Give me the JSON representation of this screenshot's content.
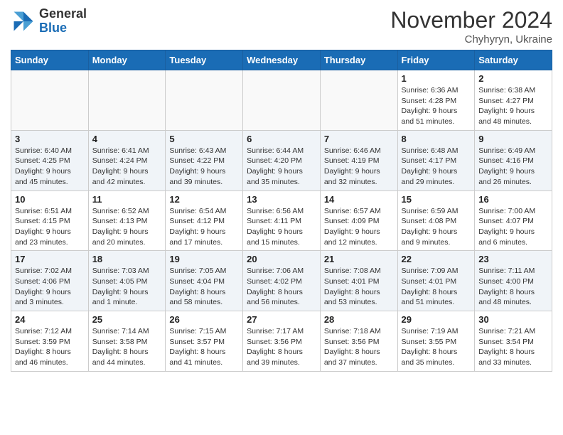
{
  "header": {
    "logo_general": "General",
    "logo_blue": "Blue",
    "month_title": "November 2024",
    "subtitle": "Chyhyryn, Ukraine"
  },
  "days_of_week": [
    "Sunday",
    "Monday",
    "Tuesday",
    "Wednesday",
    "Thursday",
    "Friday",
    "Saturday"
  ],
  "weeks": [
    [
      {
        "day": "",
        "info": ""
      },
      {
        "day": "",
        "info": ""
      },
      {
        "day": "",
        "info": ""
      },
      {
        "day": "",
        "info": ""
      },
      {
        "day": "",
        "info": ""
      },
      {
        "day": "1",
        "info": "Sunrise: 6:36 AM\nSunset: 4:28 PM\nDaylight: 9 hours\nand 51 minutes."
      },
      {
        "day": "2",
        "info": "Sunrise: 6:38 AM\nSunset: 4:27 PM\nDaylight: 9 hours\nand 48 minutes."
      }
    ],
    [
      {
        "day": "3",
        "info": "Sunrise: 6:40 AM\nSunset: 4:25 PM\nDaylight: 9 hours\nand 45 minutes."
      },
      {
        "day": "4",
        "info": "Sunrise: 6:41 AM\nSunset: 4:24 PM\nDaylight: 9 hours\nand 42 minutes."
      },
      {
        "day": "5",
        "info": "Sunrise: 6:43 AM\nSunset: 4:22 PM\nDaylight: 9 hours\nand 39 minutes."
      },
      {
        "day": "6",
        "info": "Sunrise: 6:44 AM\nSunset: 4:20 PM\nDaylight: 9 hours\nand 35 minutes."
      },
      {
        "day": "7",
        "info": "Sunrise: 6:46 AM\nSunset: 4:19 PM\nDaylight: 9 hours\nand 32 minutes."
      },
      {
        "day": "8",
        "info": "Sunrise: 6:48 AM\nSunset: 4:17 PM\nDaylight: 9 hours\nand 29 minutes."
      },
      {
        "day": "9",
        "info": "Sunrise: 6:49 AM\nSunset: 4:16 PM\nDaylight: 9 hours\nand 26 minutes."
      }
    ],
    [
      {
        "day": "10",
        "info": "Sunrise: 6:51 AM\nSunset: 4:15 PM\nDaylight: 9 hours\nand 23 minutes."
      },
      {
        "day": "11",
        "info": "Sunrise: 6:52 AM\nSunset: 4:13 PM\nDaylight: 9 hours\nand 20 minutes."
      },
      {
        "day": "12",
        "info": "Sunrise: 6:54 AM\nSunset: 4:12 PM\nDaylight: 9 hours\nand 17 minutes."
      },
      {
        "day": "13",
        "info": "Sunrise: 6:56 AM\nSunset: 4:11 PM\nDaylight: 9 hours\nand 15 minutes."
      },
      {
        "day": "14",
        "info": "Sunrise: 6:57 AM\nSunset: 4:09 PM\nDaylight: 9 hours\nand 12 minutes."
      },
      {
        "day": "15",
        "info": "Sunrise: 6:59 AM\nSunset: 4:08 PM\nDaylight: 9 hours\nand 9 minutes."
      },
      {
        "day": "16",
        "info": "Sunrise: 7:00 AM\nSunset: 4:07 PM\nDaylight: 9 hours\nand 6 minutes."
      }
    ],
    [
      {
        "day": "17",
        "info": "Sunrise: 7:02 AM\nSunset: 4:06 PM\nDaylight: 9 hours\nand 3 minutes."
      },
      {
        "day": "18",
        "info": "Sunrise: 7:03 AM\nSunset: 4:05 PM\nDaylight: 9 hours\nand 1 minute."
      },
      {
        "day": "19",
        "info": "Sunrise: 7:05 AM\nSunset: 4:04 PM\nDaylight: 8 hours\nand 58 minutes."
      },
      {
        "day": "20",
        "info": "Sunrise: 7:06 AM\nSunset: 4:02 PM\nDaylight: 8 hours\nand 56 minutes."
      },
      {
        "day": "21",
        "info": "Sunrise: 7:08 AM\nSunset: 4:01 PM\nDaylight: 8 hours\nand 53 minutes."
      },
      {
        "day": "22",
        "info": "Sunrise: 7:09 AM\nSunset: 4:01 PM\nDaylight: 8 hours\nand 51 minutes."
      },
      {
        "day": "23",
        "info": "Sunrise: 7:11 AM\nSunset: 4:00 PM\nDaylight: 8 hours\nand 48 minutes."
      }
    ],
    [
      {
        "day": "24",
        "info": "Sunrise: 7:12 AM\nSunset: 3:59 PM\nDaylight: 8 hours\nand 46 minutes."
      },
      {
        "day": "25",
        "info": "Sunrise: 7:14 AM\nSunset: 3:58 PM\nDaylight: 8 hours\nand 44 minutes."
      },
      {
        "day": "26",
        "info": "Sunrise: 7:15 AM\nSunset: 3:57 PM\nDaylight: 8 hours\nand 41 minutes."
      },
      {
        "day": "27",
        "info": "Sunrise: 7:17 AM\nSunset: 3:56 PM\nDaylight: 8 hours\nand 39 minutes."
      },
      {
        "day": "28",
        "info": "Sunrise: 7:18 AM\nSunset: 3:56 PM\nDaylight: 8 hours\nand 37 minutes."
      },
      {
        "day": "29",
        "info": "Sunrise: 7:19 AM\nSunset: 3:55 PM\nDaylight: 8 hours\nand 35 minutes."
      },
      {
        "day": "30",
        "info": "Sunrise: 7:21 AM\nSunset: 3:54 PM\nDaylight: 8 hours\nand 33 minutes."
      }
    ]
  ]
}
